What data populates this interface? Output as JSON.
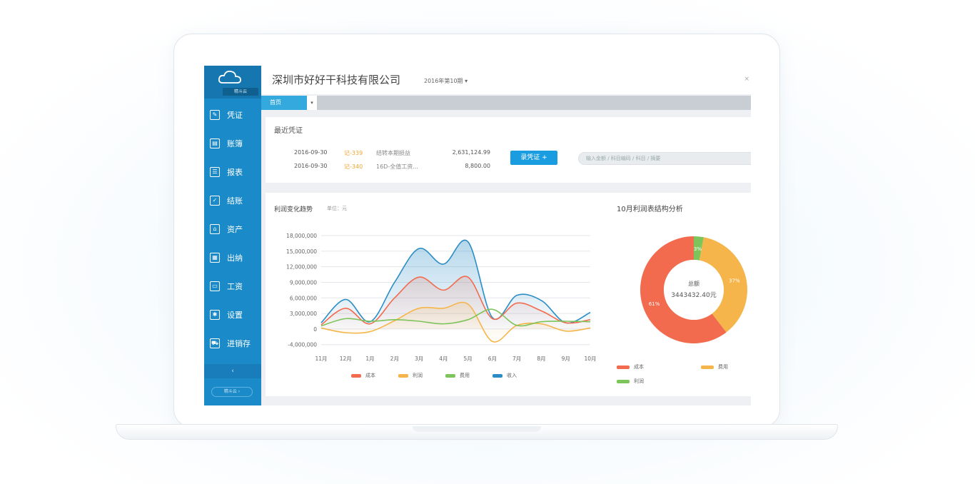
{
  "header": {
    "company": "深圳市好好干科技有限公司",
    "period": "2016年第10期 ▾",
    "close": "×"
  },
  "sidebar": {
    "logo_tag": "精斗云",
    "items": [
      {
        "label": "凭证",
        "icon": "voucher-icon"
      },
      {
        "label": "账簿",
        "icon": "ledger-icon"
      },
      {
        "label": "报表",
        "icon": "report-icon"
      },
      {
        "label": "结账",
        "icon": "checkout-icon"
      },
      {
        "label": "资产",
        "icon": "asset-icon"
      },
      {
        "label": "出纳",
        "icon": "cashier-icon"
      },
      {
        "label": "工资",
        "icon": "salary-icon"
      },
      {
        "label": "设置",
        "icon": "gear-icon"
      },
      {
        "label": "进销存",
        "icon": "cart-icon"
      }
    ],
    "collapse": "‹",
    "bottom_pill": "精斗云 ›"
  },
  "tabs": {
    "active": "首页",
    "arrow": "▾"
  },
  "vouchers": {
    "title": "最近凭证",
    "rows": [
      {
        "date": "2016-09-30",
        "no": "记-339",
        "desc": "结转本期损益",
        "amount": "2,631,124.99"
      },
      {
        "date": "2016-09-30",
        "no": "记-340",
        "desc": "16D-全值工资...",
        "amount": "8,800.00"
      }
    ],
    "new_button": "录凭证 +",
    "search_placeholder": "输入金额 / 科目编码 / 科目 / 摘要"
  },
  "chart": {
    "title": "利润变化趋势",
    "unit": "单位：元",
    "donut_title": "10月利润表结构分析"
  },
  "colors": {
    "sidebar": "#1a8ac9",
    "accent": "#1a9de0",
    "cost": "#f26b4f",
    "expense": "#f5b54a",
    "profit": "#7dc45a",
    "income": "#2c8dc5"
  },
  "chart_data": [
    {
      "type": "area",
      "categories": [
        "11月",
        "12月",
        "1月",
        "2月",
        "3月",
        "4月",
        "5月",
        "6月",
        "7月",
        "8月",
        "9月",
        "10月"
      ],
      "ylim": [
        -4000000,
        18000000
      ],
      "yticks": [
        "-4,000,000",
        "0",
        "3,000,000",
        "6,000,000",
        "9,000,000",
        "12,000,000",
        "15,000,000",
        "18,000,000"
      ],
      "ytick_values": [
        -3000000,
        0,
        3000000,
        6000000,
        9000000,
        12000000,
        15000000,
        18000000
      ],
      "grid": true,
      "legend": "bottom",
      "series": [
        {
          "name": "成本",
          "values": [
            800000,
            4000000,
            1000000,
            6000000,
            10000000,
            7500000,
            10000000,
            2000000,
            5000000,
            3500000,
            1200000,
            1800000
          ]
        },
        {
          "name": "利润",
          "values": [
            200000,
            -700000,
            -500000,
            1600000,
            4000000,
            4000000,
            4800000,
            -2400000,
            700000,
            1000000,
            -400000,
            200000
          ]
        },
        {
          "name": "费用",
          "values": [
            600000,
            2000000,
            1500000,
            1800000,
            1500000,
            1000000,
            1800000,
            3800000,
            700000,
            1400000,
            1500000,
            1400000
          ]
        },
        {
          "name": "收入",
          "values": [
            1200000,
            5700000,
            1400000,
            9000000,
            15500000,
            12500000,
            16800000,
            2200000,
            6500000,
            5500000,
            1200000,
            3200000
          ]
        }
      ]
    },
    {
      "type": "pie",
      "center_label": "总额",
      "center_value": "3443432.40元",
      "slices": [
        {
          "name": "成本",
          "value": 61,
          "label": "61%"
        },
        {
          "name": "费用",
          "value": 37,
          "label": "37%"
        },
        {
          "name": "利润",
          "value": 3,
          "label": "3%"
        }
      ],
      "legend": "bottom"
    }
  ]
}
